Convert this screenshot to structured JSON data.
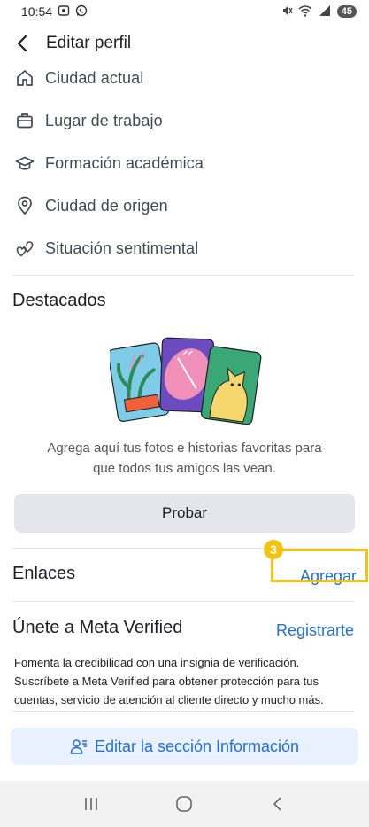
{
  "status_bar": {
    "time": "10:54",
    "battery": "45",
    "icons": [
      "screenshot-icon",
      "whatsapp-icon",
      "mute-icon",
      "wifi-icon",
      "signal-icon"
    ]
  },
  "app_bar": {
    "title": "Editar perfil"
  },
  "details": {
    "items": [
      {
        "label": "Ciudad actual",
        "icon": "home-icon"
      },
      {
        "label": "Lugar de trabajo",
        "icon": "briefcase-icon"
      },
      {
        "label": "Formación académica",
        "icon": "graduation-cap-icon"
      },
      {
        "label": "Ciudad de origen",
        "icon": "location-pin-icon"
      },
      {
        "label": "Situación sentimental",
        "icon": "hearts-icon"
      }
    ]
  },
  "featured": {
    "title": "Destacados",
    "description_line1": "Agrega aquí tus fotos e historias favoritas para",
    "description_line2": "que todos tus amigos las vean.",
    "button_label": "Probar"
  },
  "links": {
    "title": "Enlaces",
    "action_label": "Agregar",
    "annotation_badge": "3"
  },
  "meta_verified": {
    "title": "Únete a Meta Verified",
    "action_label": "Registrarte",
    "description_line1": "Fomenta la credibilidad con una insignia de verificación.",
    "description_line2": "Suscríbete a Meta Verified para obtener protección para tus",
    "description_line3": "cuentas, servicio de atención al cliente directo y mucho más."
  },
  "edit_info": {
    "label": "Editar la sección Información"
  },
  "colors": {
    "link": "#216fdb",
    "highlight": "#f1c40f",
    "button_bg": "#e4e6eb",
    "info_button_bg": "#e8f1fd"
  }
}
